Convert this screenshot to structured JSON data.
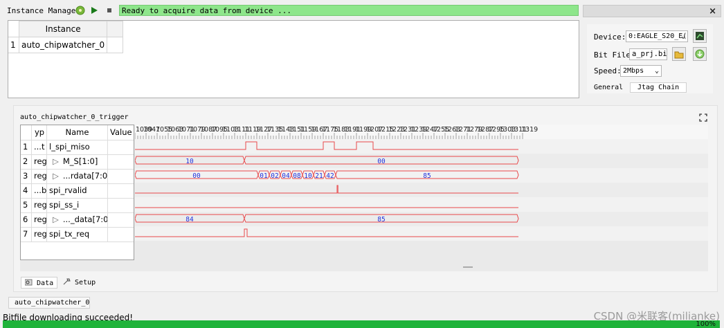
{
  "topbar": {
    "label": "Instance Manager:",
    "status": "Ready to acquire data from device ...",
    "close_glyph": "×"
  },
  "instances": {
    "header": "Instance",
    "rows": [
      {
        "num": "1",
        "name": "auto_chipwatcher_0"
      }
    ]
  },
  "device": {
    "device_label": "Device:",
    "device_value": "0:EAGLE_S20_E(",
    "bitfile_label": "Bit File:",
    "bitfile_value": "a_prj.bit",
    "speed_label": "Speed:",
    "speed_value": "2Mbps",
    "tabs": [
      "General",
      "Jtag Chain"
    ]
  },
  "trigger": {
    "title": "auto_chipwatcher_0_trigger",
    "columns": {
      "type": "yp",
      "name": "Name",
      "value": "Value"
    },
    "signals": [
      {
        "num": "1",
        "type": "...t",
        "expand": "",
        "name": "l_spi_miso"
      },
      {
        "num": "2",
        "type": "reg",
        "expand": "▷",
        "name": "M_S[1:0]"
      },
      {
        "num": "3",
        "type": "reg",
        "expand": "▷",
        "name": "...rdata[7:0]"
      },
      {
        "num": "4",
        "type": "...b",
        "expand": "",
        "name": "spi_rvalid"
      },
      {
        "num": "5",
        "type": "reg",
        "expand": "",
        "name": "spi_ss_i"
      },
      {
        "num": "6",
        "type": "reg",
        "expand": "▷",
        "name": "..._data[7:0]"
      },
      {
        "num": "7",
        "type": "reg",
        "expand": "",
        "name": "spi_tx_req"
      }
    ],
    "ruler": {
      "first_label": "1039",
      "second_label": "1047",
      "start": 1055,
      "step": 8,
      "count": 34
    },
    "waves": [
      {
        "kind": "bit",
        "segments": [
          [
            1039,
            0
          ],
          [
            1119,
            1
          ],
          [
            1127,
            0
          ],
          [
            1175,
            1
          ],
          [
            1183,
            0
          ],
          [
            1199,
            1
          ],
          [
            1211,
            0
          ],
          [
            1316,
            0
          ]
        ]
      },
      {
        "kind": "bus",
        "segments": [
          {
            "from": 1039,
            "to": 1118,
            "label": "10"
          },
          {
            "from": 1118,
            "to": 1316,
            "label": "00"
          }
        ]
      },
      {
        "kind": "bus",
        "segments": [
          {
            "from": 1039,
            "to": 1128,
            "label": "00"
          },
          {
            "from": 1128,
            "to": 1136,
            "label": "01"
          },
          {
            "from": 1136,
            "to": 1144,
            "label": "02"
          },
          {
            "from": 1144,
            "to": 1152,
            "label": "04"
          },
          {
            "from": 1152,
            "to": 1160,
            "label": "08"
          },
          {
            "from": 1160,
            "to": 1168,
            "label": "10"
          },
          {
            "from": 1168,
            "to": 1176,
            "label": "21"
          },
          {
            "from": 1176,
            "to": 1184,
            "label": "42"
          },
          {
            "from": 1184,
            "to": 1316,
            "label": "85"
          }
        ]
      },
      {
        "kind": "bit",
        "segments": [
          [
            1039,
            0
          ],
          [
            1185,
            1
          ],
          [
            1185.6,
            0
          ],
          [
            1316,
            0
          ]
        ]
      },
      {
        "kind": "bit",
        "segments": [
          [
            1039,
            0
          ],
          [
            1316,
            0
          ]
        ]
      },
      {
        "kind": "bus",
        "segments": [
          {
            "from": 1039,
            "to": 1118,
            "label": "84"
          },
          {
            "from": 1118,
            "to": 1316,
            "label": "85"
          }
        ]
      },
      {
        "kind": "bit",
        "segments": [
          [
            1039,
            0
          ],
          [
            1118,
            1
          ],
          [
            1120,
            0
          ],
          [
            1316,
            0
          ]
        ]
      }
    ],
    "bottom_tabs": [
      "Data",
      "Setup"
    ]
  },
  "instance_tab": "auto_chipwatcher_0",
  "message": "Bitfile downloading succeeded!",
  "progress": {
    "value": 100,
    "label": "100%"
  },
  "watermark": "CSDN @米联客(milianke)",
  "colors": {
    "wave": "#e8484a",
    "bus_text": "#2233dd",
    "status_bg": "#8ee68b",
    "progress": "#1fb33a"
  }
}
